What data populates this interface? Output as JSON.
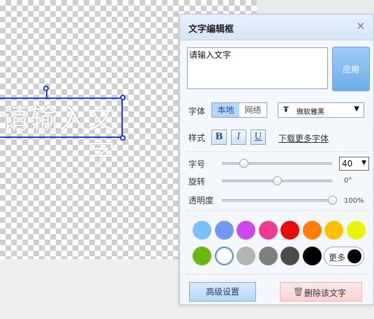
{
  "canvas": {
    "text_content": "请输入文字"
  },
  "panel": {
    "title": "文字编辑框",
    "text_input_value": "请输入文字",
    "apply_label": "应用",
    "font_label": "字体",
    "font_source_tabs": [
      "本地",
      "网络"
    ],
    "font_select_icon": "Ŧ",
    "font_name": "微软雅黑",
    "style_label": "样式",
    "style_buttons": [
      "B",
      "I",
      "U"
    ],
    "more_fonts_link": "下载更多字体",
    "size_label": "字号",
    "size_value": "40",
    "rotate_label": "旋转",
    "rotate_value": "0°",
    "opacity_label": "透明度",
    "opacity_value": "100%",
    "more_colors_label": "更多",
    "advanced_label": "高级设置",
    "delete_label": "删除该文字"
  },
  "colors": {
    "palette_row1": [
      "#7cc0fb",
      "#7198f7",
      "#cc49f0",
      "#f03b94",
      "#ea0c0c",
      "#ff7e0a",
      "#ffc000",
      "#e8f40b"
    ],
    "palette_row2": [
      "#6bb80e",
      "#ffffff",
      "#b3b3b3",
      "#7f7f7f",
      "#4c4c4c",
      "#000000"
    ],
    "selected_color": "#ffffff",
    "accent": "#1e3cd6"
  },
  "sliders": {
    "size_fraction": 0.2,
    "rotate_fraction": 0.5,
    "opacity_fraction": 1.0
  }
}
